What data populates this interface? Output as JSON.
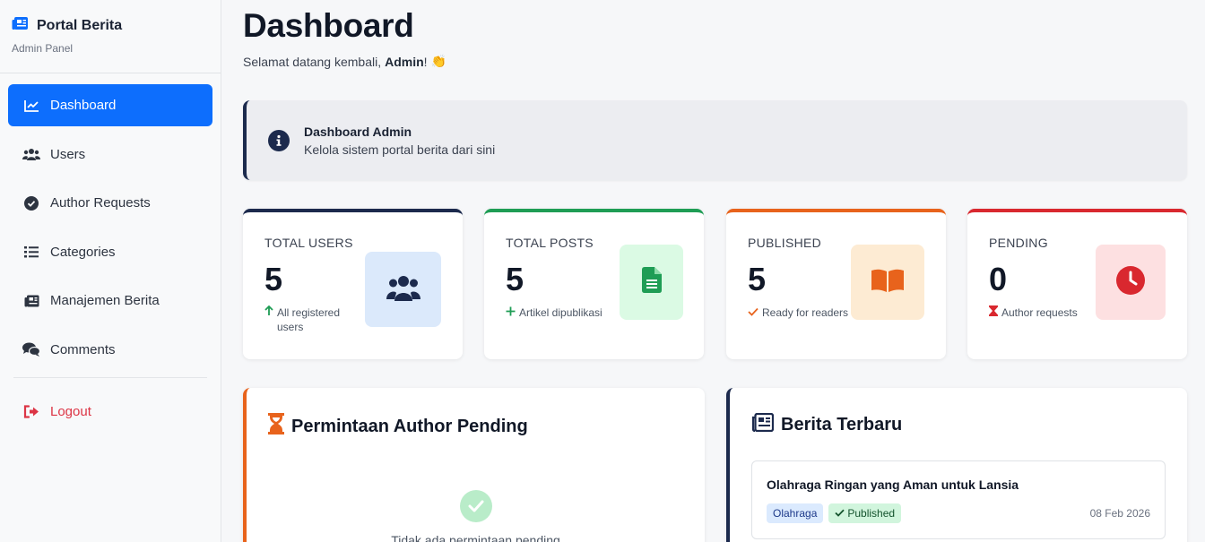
{
  "brand": {
    "title": "Portal Berita",
    "subtitle": "Admin Panel"
  },
  "nav": {
    "items": [
      {
        "label": "Dashboard",
        "icon": "chart-line-icon",
        "active": true
      },
      {
        "label": "Users",
        "icon": "users-icon"
      },
      {
        "label": "Author Requests",
        "icon": "check-circle-icon"
      },
      {
        "label": "Categories",
        "icon": "list-icon"
      },
      {
        "label": "Manajemen Berita",
        "icon": "newspaper-icon"
      },
      {
        "label": "Comments",
        "icon": "comments-icon"
      }
    ],
    "logout": "Logout"
  },
  "page": {
    "title": "Dashboard",
    "welcome_prefix": "Selamat datang kembali,",
    "welcome_name": "Admin",
    "welcome_suffix": "!",
    "welcome_emoji": "👏"
  },
  "alert": {
    "title": "Dashboard Admin",
    "text": "Kelola sistem portal berita dari sini"
  },
  "stats": [
    {
      "label": "TOTAL USERS",
      "value": "5",
      "note": "All registered users",
      "color": "#1c2a4d",
      "icon_bg": "#dbe9fb"
    },
    {
      "label": "TOTAL POSTS",
      "value": "5",
      "note": "Artikel dipublikasi",
      "color": "#1f9d55",
      "icon_bg": "#dbfae4"
    },
    {
      "label": "PUBLISHED",
      "value": "5",
      "note": "Ready for readers",
      "color": "#e8631c",
      "icon_bg": "#fdebd3"
    },
    {
      "label": "PENDING",
      "value": "0",
      "note": "Author requests",
      "color": "#d9282f",
      "icon_bg": "#fde0e1"
    }
  ],
  "pending_panel": {
    "title": "Permintaan Author Pending",
    "empty_text": "Tidak ada permintaan pending"
  },
  "news_panel": {
    "title": "Berita Terbaru",
    "items": [
      {
        "title": "Olahraga Ringan yang Aman untuk Lansia",
        "category": "Olahraga",
        "status": "Published",
        "date": "08 Feb 2026"
      }
    ]
  },
  "colors": {
    "primary": "#0d6efd",
    "navy": "#1c2a4d",
    "orange": "#e8631c",
    "danger": "#dc3545",
    "green": "#1f9d55"
  }
}
